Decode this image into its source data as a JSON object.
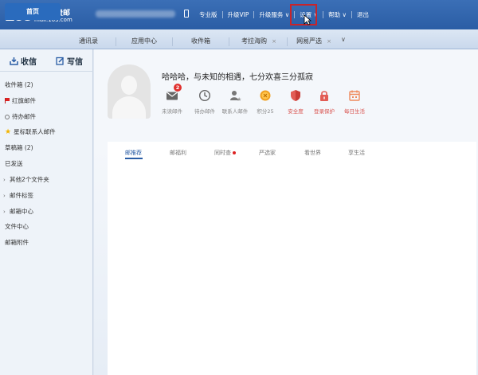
{
  "header": {
    "logo_number": "163",
    "logo_title": "网易免费邮",
    "logo_domain": "mail.163.com",
    "links": [
      "专业版",
      "升级VIP",
      "升级服务 ∨",
      "设置 ∨",
      "帮助 ∨",
      "退出"
    ]
  },
  "tabs": [
    {
      "label": "首页",
      "active": true
    },
    {
      "label": "通讯录"
    },
    {
      "label": "应用中心"
    },
    {
      "label": "收件箱"
    },
    {
      "label": "考拉海购",
      "closable": true
    },
    {
      "label": "网易严选",
      "closable": true
    }
  ],
  "tab_more": "∨",
  "sidebar": {
    "receive": "收信",
    "write": "写信",
    "folders": [
      {
        "label": "收件箱 (2)"
      },
      {
        "label": "红旗邮件"
      },
      {
        "label": "待办邮件"
      },
      {
        "label": "星标联系人邮件"
      },
      {
        "label": "草稿箱 (2)"
      },
      {
        "label": "已发送"
      },
      {
        "label": "其他2个文件夹"
      },
      {
        "label": "邮件标签"
      },
      {
        "label": "邮箱中心"
      },
      {
        "label": "文件中心"
      },
      {
        "label": "邮箱附件"
      }
    ]
  },
  "main": {
    "greeting": "哈哈哈，与未知的相遇，七分欢喜三分孤寂",
    "stats": [
      {
        "label": "未读邮件",
        "badge": "2"
      },
      {
        "label": "待办邮件"
      },
      {
        "label": "联系人邮件"
      },
      {
        "label": "积分25"
      },
      {
        "label": "安全度"
      },
      {
        "label": "登录保护"
      },
      {
        "label": "每日生活"
      }
    ],
    "content_tabs": [
      "邮推荐",
      "邮福利",
      "同时查",
      "严选家",
      "看世界",
      "享生活"
    ]
  },
  "colors": {
    "header_bg": "#2a5da5",
    "highlight": "#c8242a",
    "badge": "#e0302e"
  }
}
